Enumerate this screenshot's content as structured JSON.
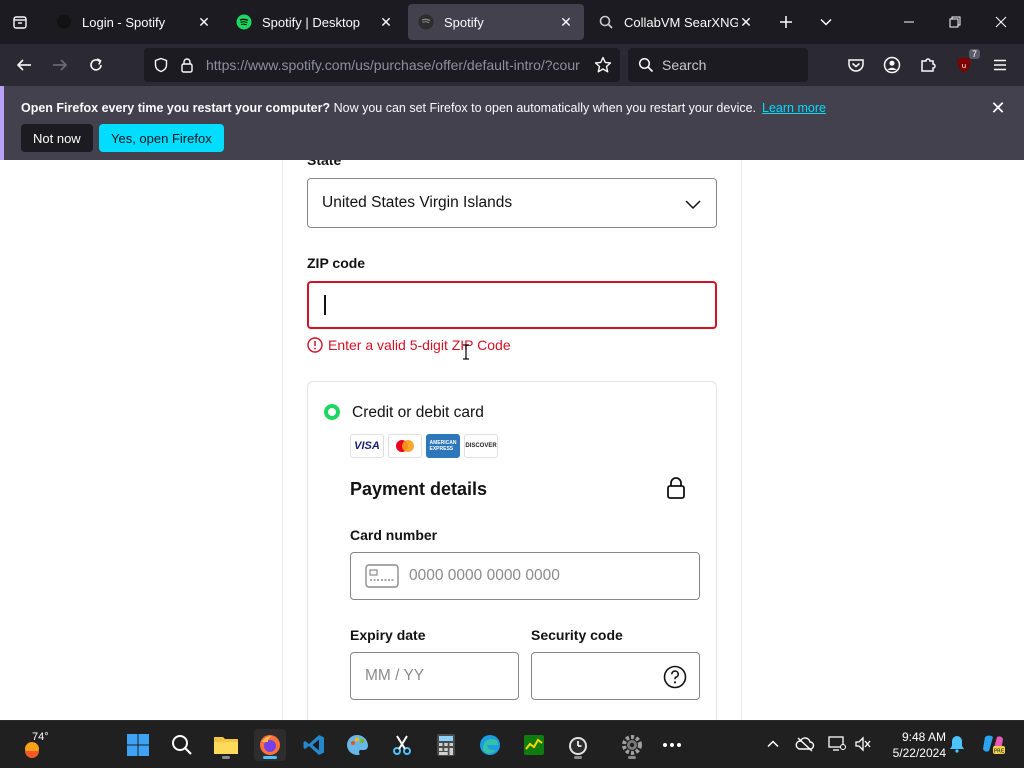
{
  "browser": {
    "tabs": [
      {
        "title": "Login - Spotify",
        "active": false
      },
      {
        "title": "Spotify | Desktop",
        "active": false
      },
      {
        "title": "Spotify",
        "active": true
      },
      {
        "title": "CollabVM SearXNG",
        "active": false
      }
    ],
    "url": "https://www.spotify.com/us/purchase/offer/default-intro/?country=VI",
    "url_visible": "https://www.spotify.com/us/purchase/offer/default-intro/?cour",
    "search_placeholder": "Search",
    "extension_badge": "7"
  },
  "notification": {
    "bold_text": "Open Firefox every time you restart your computer?",
    "text": " Now you can set Firefox to open automatically when you restart your device.",
    "link": "Learn more",
    "not_now": "Not now",
    "yes_open": "Yes, open Firefox"
  },
  "form": {
    "state_label": "State",
    "state_value": "United States Virgin Islands",
    "zip_label": "ZIP code",
    "zip_value": "",
    "zip_error": "Enter a valid 5-digit ZIP Code",
    "payment_method_label": "Credit or debit card",
    "card_logos": [
      "VISA",
      "Mastercard",
      "American Express",
      "DISCOVER"
    ],
    "payment_title": "Payment details",
    "card_number_label": "Card number",
    "card_number_placeholder": "0000 0000 0000 0000",
    "expiry_label": "Expiry date",
    "expiry_placeholder": "MM / YY",
    "security_label": "Security code"
  },
  "taskbar": {
    "weather_temp": "74°",
    "time": "9:48 AM",
    "date": "5/22/2024"
  },
  "colors": {
    "error_red": "#d31225",
    "spotify_green": "#1ed760",
    "firefox_accent": "#00ddff"
  }
}
